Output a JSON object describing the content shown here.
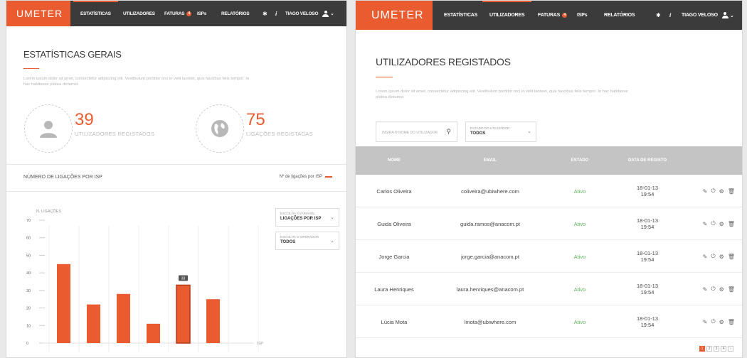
{
  "nav": {
    "logo": "UMETER",
    "items": [
      "ESTATÍSTICAS",
      "UTILIZADORES",
      "FATURAS",
      "ISPs",
      "RELATÓRIOS"
    ],
    "faturas_badge": "4",
    "user": "TIAGO VELOSO",
    "settings_icon": "gear-icon",
    "info_icon": "info-icon"
  },
  "stats": {
    "title": "ESTATÍSTICAS GERAIS",
    "description": "Lorem ipsum dolor sit amet, consectetur adipiscing elit. Vestibulum porttitor orci in velit laoreet, quis faucibus felis tempor. In hac habitasse platea dictumst.",
    "users_count": "39",
    "users_label": "UTILIZADORES REGISTADOS",
    "connections_count": "75",
    "connections_label": "LIGAÇÕES REGISTADAS"
  },
  "chart_section": {
    "title": "NÚMERO DE LIGAÇÕES POR ISP",
    "legend": "Nº de ligações por ISP",
    "variable_small": "ESCOLHA A VARIÁVEL",
    "variable_value": "LIGAÇÕES POR ISP",
    "operator_small": "ESCOLHA O OPERADOR",
    "operator_value": "TODOS"
  },
  "chart_data": {
    "type": "bar",
    "ylabel": "N. LIGAÇÕES",
    "xlabel": "ISP",
    "ylim": [
      0,
      70
    ],
    "yticks": [
      0,
      10,
      20,
      30,
      40,
      50,
      60,
      70
    ],
    "values": [
      45,
      22,
      28,
      11,
      33,
      25
    ],
    "highlighted_value": "33",
    "highlight_index": 4,
    "color": "#ea5b2f"
  },
  "users": {
    "title": "UTILIZADORES REGISTADOS",
    "description": "Lorem ipsum dolor sit amet, consectetur adipiscing elit. Vestibulum porttitor orci in velit laoreet, quis faucibus felis tempor. In hac habitasse platea dictumst.",
    "search_placeholder": "INSIRA O NOME DO UTILIZADOR",
    "status_filter_small": "ESTADO DO UTILIZADOR",
    "status_filter_value": "TODOS",
    "columns": [
      "NOME",
      "EMAIL",
      "ESTADO",
      "DATA DE REGISTO"
    ],
    "rows": [
      {
        "name": "Carlos Oliveira",
        "email": "coliveira@ubiwhere.com",
        "status": "Ativo",
        "date": "18-01-13",
        "time": "19:54"
      },
      {
        "name": "Guida Oliveira",
        "email": "guida.ramos@anacom.pt",
        "status": "Ativo",
        "date": "18-01-13",
        "time": "19:54"
      },
      {
        "name": "Jorge Garcia",
        "email": "jorge.garcia@anacom.pt",
        "status": "Ativo",
        "date": "18-01-13",
        "time": "19:54"
      },
      {
        "name": "Laura Henriques",
        "email": "laura.henriques@anacom.pt",
        "status": "Ativo",
        "date": "18-01-13",
        "time": "19:54"
      },
      {
        "name": "Lúcia Mota",
        "email": "lmota@ubiwhere.com",
        "status": "Ativo",
        "date": "18-01-13",
        "time": "19:54"
      }
    ],
    "pages": [
      "1",
      "2",
      "3",
      "4",
      "›"
    ],
    "status_color": "#5cb85c"
  }
}
